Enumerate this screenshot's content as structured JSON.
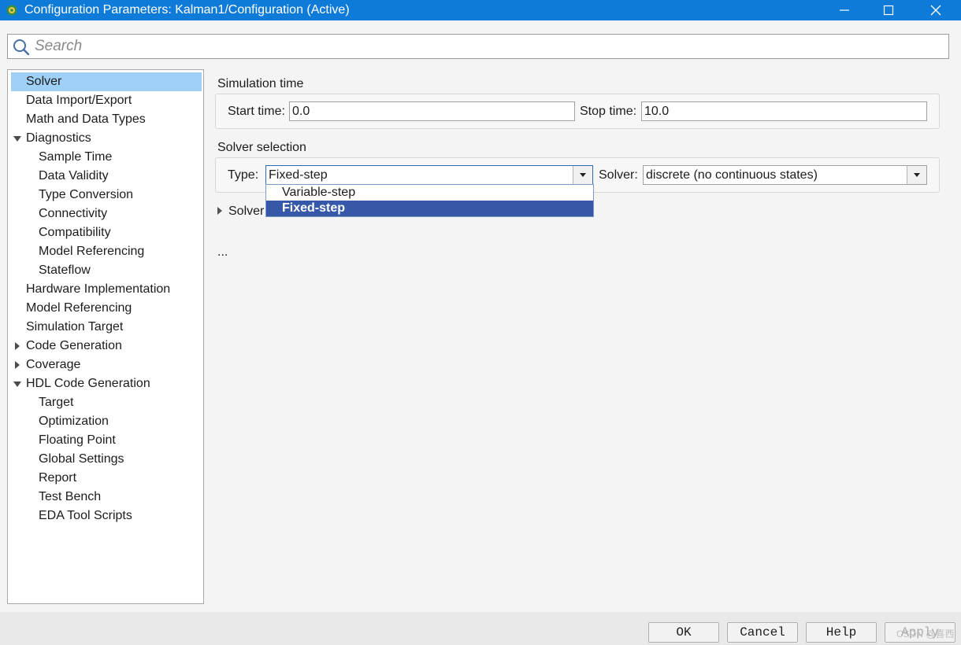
{
  "window": {
    "title": "Configuration Parameters: Kalman1/Configuration (Active)",
    "icon": "gear-icon",
    "accent": "#0f7bd9"
  },
  "search": {
    "placeholder": "Search",
    "value": ""
  },
  "tree": {
    "items": [
      {
        "label": "Solver",
        "selected": true
      },
      {
        "label": "Data Import/Export"
      },
      {
        "label": "Math and Data Types"
      },
      {
        "label": "Diagnostics",
        "expanded": true
      },
      {
        "label": "Sample Time"
      },
      {
        "label": "Data Validity"
      },
      {
        "label": "Type Conversion"
      },
      {
        "label": "Connectivity"
      },
      {
        "label": "Compatibility"
      },
      {
        "label": "Model Referencing"
      },
      {
        "label": "Stateflow"
      },
      {
        "label": "Hardware Implementation"
      },
      {
        "label": "Model Referencing"
      },
      {
        "label": "Simulation Target"
      },
      {
        "label": "Code Generation",
        "expanded": false
      },
      {
        "label": "Coverage",
        "expanded": false
      },
      {
        "label": "HDL Code Generation",
        "expanded": true
      },
      {
        "label": "Target"
      },
      {
        "label": "Optimization"
      },
      {
        "label": "Floating Point"
      },
      {
        "label": "Global Settings"
      },
      {
        "label": "Report"
      },
      {
        "label": "Test Bench"
      },
      {
        "label": "EDA Tool Scripts"
      }
    ]
  },
  "solver_panel": {
    "simulation_time": {
      "title": "Simulation time",
      "start_label": "Start time:",
      "start_value": "0.0",
      "stop_label": "Stop time:",
      "stop_value": "10.0"
    },
    "solver_selection": {
      "title": "Solver selection",
      "type_label": "Type:",
      "type_value": "Fixed-step",
      "type_options": [
        "Variable-step",
        "Fixed-step"
      ],
      "solver_label": "Solver:",
      "solver_value": "discrete (no continuous states)"
    },
    "solver_details_label": "Solver",
    "ellipsis": "..."
  },
  "buttons": {
    "ok": "OK",
    "cancel": "Cancel",
    "help": "Help",
    "apply": "Apply"
  },
  "watermark": "CSDN @喜西"
}
